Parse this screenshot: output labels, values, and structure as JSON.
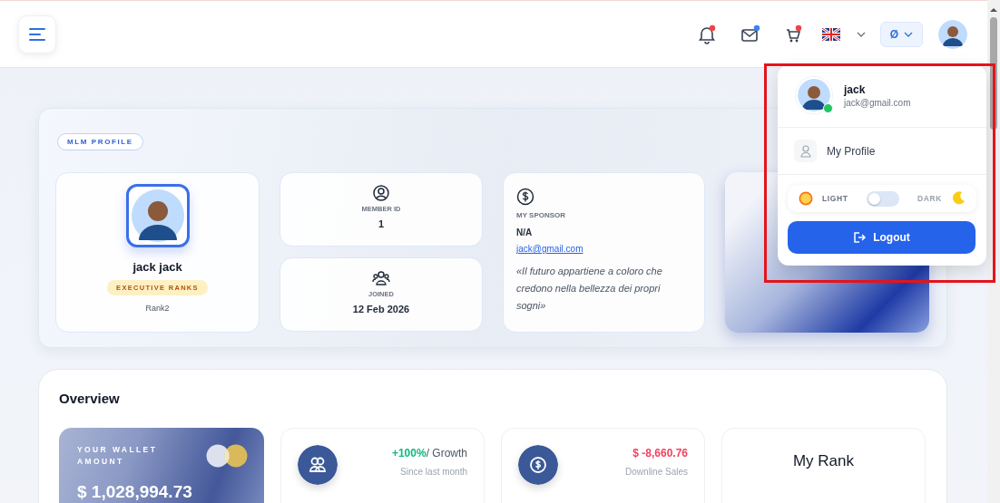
{
  "header": {
    "icons": [
      {
        "kind": "bell",
        "color": "#ef4444"
      },
      {
        "kind": "mail",
        "color": "#3b82f6"
      },
      {
        "kind": "cart",
        "color": "#ef4444"
      }
    ],
    "currency": "Ø"
  },
  "user_menu": {
    "name": "jack",
    "email": "jack@gmail.com",
    "online": true,
    "items": [
      "My Profile"
    ],
    "theme": {
      "light_label": "LIGHT",
      "dark_label": "DARK",
      "dark": false
    },
    "logout": "Logout"
  },
  "profile": {
    "badge": "MLM PROFILE",
    "name": "jack jack",
    "rank_badge": "EXECUTIVE RANKS",
    "rank": "Rank2",
    "member_id": {
      "label": "MEMBER ID",
      "value": "1"
    },
    "joined": {
      "label": "JOINED",
      "value": "12 Feb 2026"
    },
    "sponsor": {
      "label": "MY SPONSOR",
      "name": "N/A",
      "email": "jack@gmail.com",
      "quote": "«Il futuro appartiene a coloro che credono nella bellezza dei propri sogni»"
    }
  },
  "overview": {
    "title": "Overview",
    "wallet": {
      "label": "YOUR WALLET AMOUNT",
      "amount": "$ 1,028,994.73"
    },
    "stats": [
      {
        "kind": "growth",
        "value": "+100%",
        "suffix": "/ Growth",
        "caption": "Since last month",
        "color": "#10b981"
      },
      {
        "kind": "sales",
        "value": "$ -8,660.76",
        "caption": "Downline Sales",
        "color": "#f43f5e"
      }
    ],
    "rank_title": "My Rank"
  }
}
